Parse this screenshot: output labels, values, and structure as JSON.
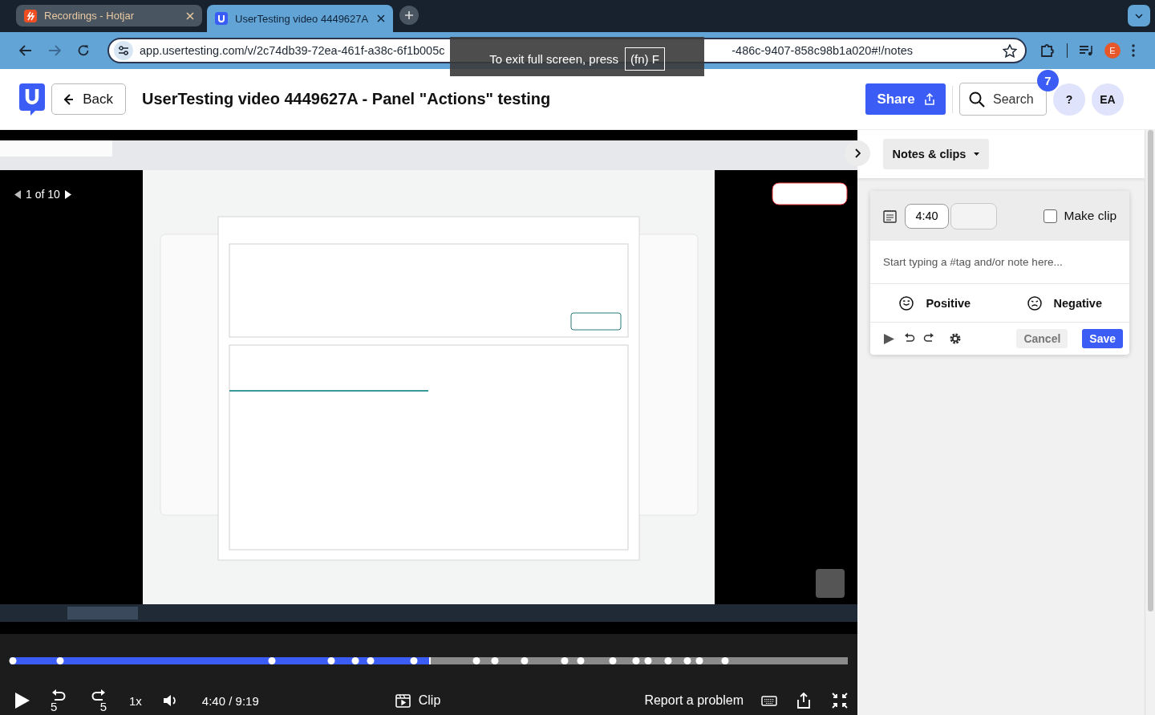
{
  "browser": {
    "tabs": [
      {
        "title": "Recordings - Hotjar",
        "selected": false
      },
      {
        "title": "UserTesting video 4449627A",
        "selected": true
      }
    ],
    "url_start": "app.usertesting.com/v/2c74db39-72ea-461f-a38c-6f1b005c",
    "url_end": "-486c-9407-858c98b1a020#!/notes",
    "profile": "E",
    "fullscreen_toast": {
      "text": "To exit full screen, press",
      "key": "(fn) F"
    }
  },
  "header": {
    "back": "Back",
    "title": "UserTesting video 4449627A - Panel \"Actions\" testing",
    "share": "Share",
    "search": "Search",
    "badge": "7",
    "help": "?",
    "avatar": "EA"
  },
  "player": {
    "overlay": {
      "counter": "1 of 10"
    },
    "progress": {
      "level": 0.5
    },
    "skip_seconds": [
      "5",
      "5"
    ],
    "time": "4:40 / 9:19",
    "speed": "1x",
    "clip": "Clip",
    "report": "Report a problem"
  },
  "notes": {
    "dropdown": "Notes & clips",
    "timestamp": "4:40",
    "make_clip": {
      "label": "Make clip",
      "checked": false
    },
    "note": {
      "placeholder": "Start typing a #tag and/or note here..."
    },
    "sentiments": [
      {
        "label": "Positive",
        "kind": "positive"
      },
      {
        "label": "Negative",
        "kind": "negative"
      }
    ],
    "cancel": "Cancel",
    "save": "Save"
  }
}
